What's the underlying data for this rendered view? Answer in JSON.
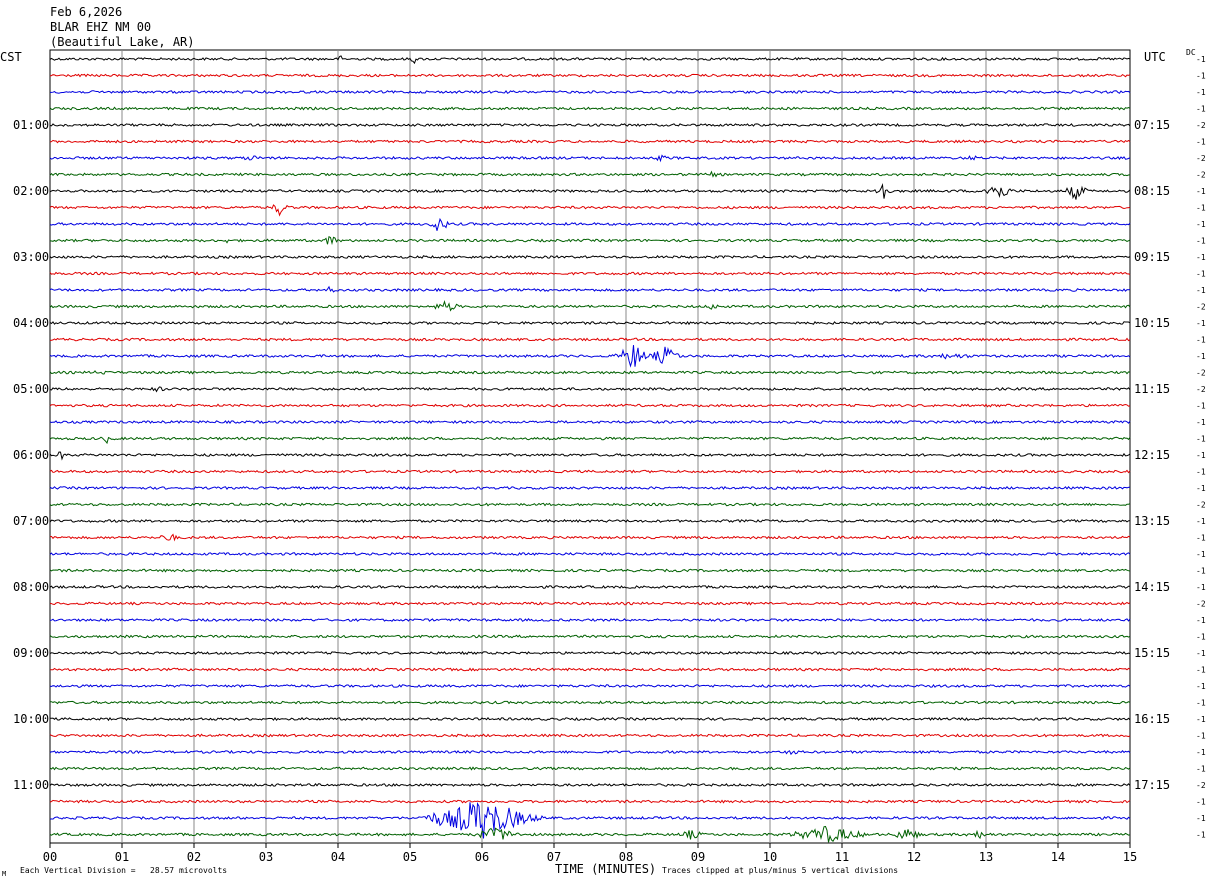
{
  "header": {
    "date": "Feb 6,2026",
    "station": "BLAR EHZ NM 00",
    "location": "(Beautiful Lake, AR)"
  },
  "left_timezone": "CST",
  "right_timezone": "UTC",
  "dc_label": "DC",
  "footer": {
    "vertical_division": "Each Vertical Division =   28.57 microvolts",
    "clipping": "Traces clipped at plus/minus 5 vertical divisions",
    "mark": "M"
  },
  "chart_data": {
    "type": "line",
    "title": "",
    "xlabel": "TIME (MINUTES)",
    "ylabel": "",
    "xlim": [
      0,
      15
    ],
    "x_ticks": [
      "00",
      "01",
      "02",
      "03",
      "04",
      "05",
      "06",
      "07",
      "08",
      "09",
      "10",
      "11",
      "12",
      "13",
      "14",
      "15"
    ],
    "trace_count": 48,
    "minutes_per_trace": 15,
    "trace_colors": [
      "#000000",
      "#e00000",
      "#0000e0",
      "#006000"
    ],
    "left_time_labels": [
      {
        "trace": 4,
        "label": "01:00"
      },
      {
        "trace": 8,
        "label": "02:00"
      },
      {
        "trace": 12,
        "label": "03:00"
      },
      {
        "trace": 16,
        "label": "04:00"
      },
      {
        "trace": 20,
        "label": "05:00"
      },
      {
        "trace": 24,
        "label": "06:00"
      },
      {
        "trace": 28,
        "label": "07:00"
      },
      {
        "trace": 32,
        "label": "08:00"
      },
      {
        "trace": 36,
        "label": "09:00"
      },
      {
        "trace": 40,
        "label": "10:00"
      },
      {
        "trace": 44,
        "label": "11:00"
      }
    ],
    "right_time_labels": [
      {
        "trace": 4,
        "label": "07:15"
      },
      {
        "trace": 8,
        "label": "08:15"
      },
      {
        "trace": 12,
        "label": "09:15"
      },
      {
        "trace": 16,
        "label": "10:15"
      },
      {
        "trace": 20,
        "label": "11:15"
      },
      {
        "trace": 24,
        "label": "12:15"
      },
      {
        "trace": 28,
        "label": "13:15"
      },
      {
        "trace": 32,
        "label": "14:15"
      },
      {
        "trace": 36,
        "label": "15:15"
      },
      {
        "trace": 40,
        "label": "16:15"
      },
      {
        "trace": 44,
        "label": "17:15"
      }
    ],
    "dc_offsets": [
      "-1",
      "-1",
      "-1",
      "-1",
      "-2",
      "-1",
      "-2",
      "-2",
      "-1",
      "-1",
      "-1",
      "-1",
      "-1",
      "-1",
      "-1",
      "-2",
      "-1",
      "-1",
      "-1",
      "-2",
      "-2",
      "-1",
      "-1",
      "-1",
      "-1",
      "-1",
      "-1",
      "-2",
      "-1",
      "-1",
      "-1",
      "-1",
      "-1",
      "-2",
      "-1",
      "-1",
      "-1",
      "-1",
      "-1",
      "-1",
      "-1",
      "-1",
      "-1",
      "-1",
      "-2",
      "-1",
      "-1",
      "-1"
    ],
    "noise_level": 1.2,
    "events": [
      {
        "trace": 0,
        "minute": 4.05,
        "amplitude": 5,
        "duration": 0.1
      },
      {
        "trace": 0,
        "minute": 5.05,
        "amplitude": 6,
        "duration": 0.1
      },
      {
        "trace": 6,
        "minute": 2.8,
        "amplitude": 3,
        "duration": 0.4
      },
      {
        "trace": 6,
        "minute": 8.5,
        "amplitude": 3,
        "duration": 0.4
      },
      {
        "trace": 6,
        "minute": 12.8,
        "amplitude": 3,
        "duration": 0.3
      },
      {
        "trace": 7,
        "minute": 9.2,
        "amplitude": 3,
        "duration": 0.3
      },
      {
        "trace": 8,
        "minute": 11.55,
        "amplitude": 14,
        "duration": 0.2
      },
      {
        "trace": 8,
        "minute": 13.15,
        "amplitude": 10,
        "duration": 0.4
      },
      {
        "trace": 8,
        "minute": 14.25,
        "amplitude": 9,
        "duration": 0.3
      },
      {
        "trace": 9,
        "minute": 3.2,
        "amplitude": 10,
        "duration": 0.2
      },
      {
        "trace": 10,
        "minute": 5.4,
        "amplitude": 8,
        "duration": 0.3
      },
      {
        "trace": 11,
        "minute": 3.9,
        "amplitude": 6,
        "duration": 0.25
      },
      {
        "trace": 11,
        "minute": 2.45,
        "amplitude": 3,
        "duration": 0.1
      },
      {
        "trace": 14,
        "minute": 3.9,
        "amplitude": 4,
        "duration": 0.2
      },
      {
        "trace": 15,
        "minute": 5.5,
        "amplitude": 6,
        "duration": 0.4
      },
      {
        "trace": 15,
        "minute": 9.2,
        "amplitude": 4,
        "duration": 0.2
      },
      {
        "trace": 18,
        "minute": 8.1,
        "amplitude": 14,
        "duration": 0.4
      },
      {
        "trace": 18,
        "minute": 8.55,
        "amplitude": 10,
        "duration": 0.4
      },
      {
        "trace": 18,
        "minute": 12.5,
        "amplitude": 3,
        "duration": 1.0
      },
      {
        "trace": 19,
        "minute": 0.7,
        "amplitude": 3,
        "duration": 0.3
      },
      {
        "trace": 20,
        "minute": 1.5,
        "amplitude": 3,
        "duration": 0.3
      },
      {
        "trace": 23,
        "minute": 0.8,
        "amplitude": 5,
        "duration": 0.2
      },
      {
        "trace": 24,
        "minute": 0.15,
        "amplitude": 5,
        "duration": 0.15
      },
      {
        "trace": 29,
        "minute": 1.65,
        "amplitude": 5,
        "duration": 0.3
      },
      {
        "trace": 42,
        "minute": 10.3,
        "amplitude": 3,
        "duration": 0.3
      },
      {
        "trace": 46,
        "minute": 6.0,
        "amplitude": 22,
        "duration": 1.2
      },
      {
        "trace": 46,
        "minute": 5.4,
        "amplitude": 8,
        "duration": 0.5
      },
      {
        "trace": 47,
        "minute": 6.2,
        "amplitude": 8,
        "duration": 0.6
      },
      {
        "trace": 47,
        "minute": 8.9,
        "amplitude": 5,
        "duration": 0.4
      },
      {
        "trace": 47,
        "minute": 10.8,
        "amplitude": 9,
        "duration": 1.0
      },
      {
        "trace": 47,
        "minute": 11.9,
        "amplitude": 7,
        "duration": 0.4
      },
      {
        "trace": 47,
        "minute": 12.9,
        "amplitude": 4,
        "duration": 0.5
      }
    ]
  }
}
